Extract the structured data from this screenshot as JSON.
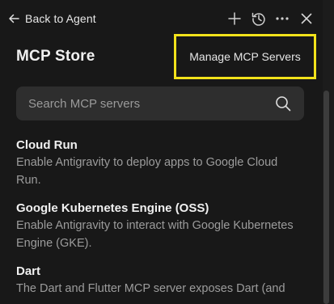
{
  "header": {
    "back_label": "Back to Agent",
    "icons": [
      "arrow-left-icon",
      "plus-icon",
      "history-icon",
      "more-icon",
      "close-icon"
    ]
  },
  "page": {
    "title": "MCP Store",
    "manage_label": "Manage MCP Servers"
  },
  "search": {
    "placeholder": "Search MCP servers",
    "value": ""
  },
  "servers": [
    {
      "name": "Cloud Run",
      "description_lines": [
        "Enable Antigravity to deploy apps to Google Cloud",
        "Run."
      ]
    },
    {
      "name": "Google Kubernetes Engine (OSS)",
      "description_lines": [
        "Enable Antigravity to interact with Google Kubernetes",
        "Engine (GKE)."
      ]
    },
    {
      "name": "Dart",
      "description_lines": [
        "The Dart and Flutter MCP server exposes Dart (and"
      ]
    }
  ],
  "colors": {
    "background": "#181818",
    "highlight_border": "#f2e21b",
    "search_bg": "#2e2e2e",
    "muted_text": "#9c9c9c"
  }
}
